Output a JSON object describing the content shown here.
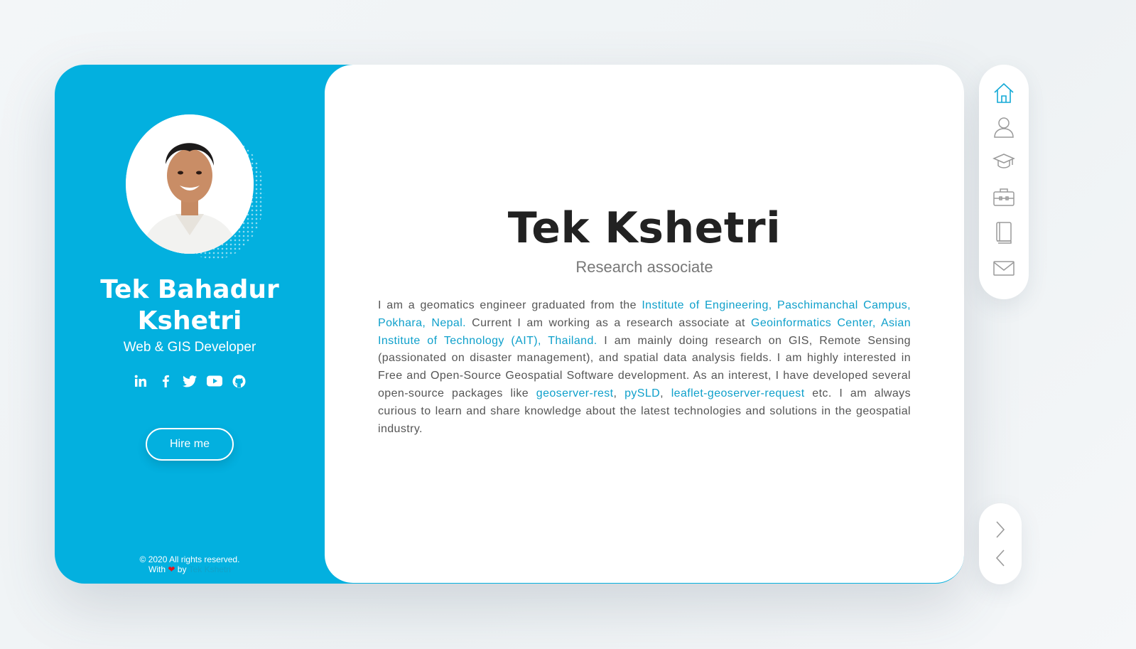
{
  "profile": {
    "name": "Tek Bahadur Kshetri",
    "role": "Web & GIS Developer",
    "hire_label": "Hire me",
    "socials": [
      "linkedin-icon",
      "facebook-icon",
      "twitter-icon",
      "youtube-icon",
      "github-icon"
    ]
  },
  "footer": {
    "copyright": "© 2020 All rights reserved.",
    "with": "With",
    "heart": "❤",
    "by": "by",
    "author": "Tek Kshetri"
  },
  "main": {
    "title": "Tek Kshetri",
    "subtitle": "Research associate",
    "bio": {
      "t1": "I am a geomatics engineer graduated from the ",
      "l1": "Institute of Engineering, Paschimanchal Campus, Pokhara, Nepal.",
      "t2": " Current I am working as a research associate at ",
      "l2": "Geoinformatics Center, Asian Institute of Technology (AIT), Thailand.",
      "t3": " I am mainly doing research on GIS, Remote Sensing (passionated on disaster management), and spatial data analysis fields. I am highly interested in Free and Open-Source Geospatial Software development. As an interest, I have developed several open-source packages like ",
      "l3": "geoserver-rest",
      "c1": ", ",
      "l4": "pySLD",
      "c2": ", ",
      "l5": "leaflet-geoserver-request",
      "t4": " etc. I am always curious to learn and share knowledge about the latest technologies and solutions in the geospatial industry."
    }
  },
  "nav": {
    "items": [
      "home-icon",
      "user-icon",
      "graduation-cap-icon",
      "briefcase-icon",
      "book-icon",
      "envelope-icon"
    ],
    "active": "home-icon"
  },
  "pager": {
    "items": [
      "chevron-right-icon",
      "chevron-left-icon"
    ]
  },
  "colors": {
    "accent": "#03b0df",
    "link": "#0fa0cb",
    "heart": "#e0151f"
  }
}
